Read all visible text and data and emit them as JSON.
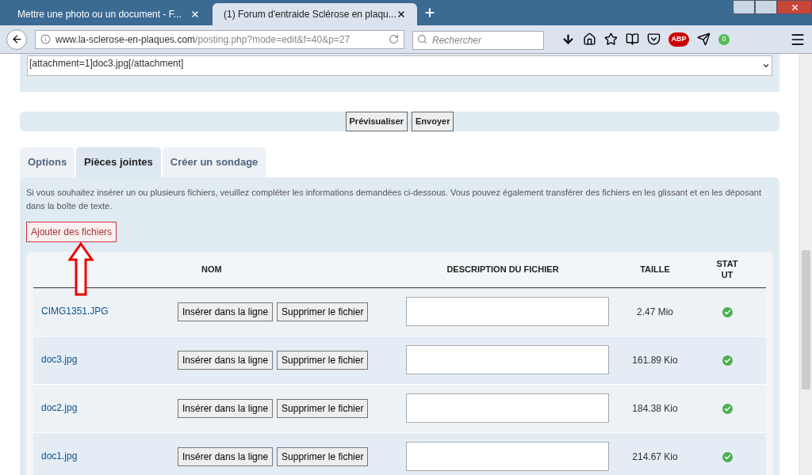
{
  "browser": {
    "tabs": [
      {
        "title": "Mettre une photo ou un document - F...",
        "selected": false
      },
      {
        "title": "(1) Forum d'entraide Sclérose en plaqu...",
        "selected": true
      }
    ],
    "url": {
      "domain": "www.la-sclerose-en-plaques.com",
      "path": "/posting.php?mode=edit&f=40&p=27"
    },
    "search": {
      "placeholder": "Rechercher"
    },
    "addon_badge": "0",
    "abp_label": "ABP"
  },
  "editor": {
    "value": "[attachment=1]doc3.jpg[/attachment]"
  },
  "actions": [
    "Prévisualiser",
    "Envoyer"
  ],
  "panel_tabs": [
    {
      "label": "Options",
      "selected": false
    },
    {
      "label": "Pièces jointes",
      "selected": true
    },
    {
      "label": "Créer un sondage",
      "selected": false
    }
  ],
  "intro": "Si vous souhaitez insérer un ou plusieurs fichiers, veuillez compléter les informations demandées ci-dessous. Vous pouvez également transférer des fichiers en les glissant et en les déposant dans la boîte de texte.",
  "add_files_button": "Ajouter des fichiers",
  "table": {
    "columns": [
      "NOM",
      "DESCRIPTION DU FICHIER",
      "TAILLE",
      "STATUT"
    ],
    "rows": [
      {
        "name": "CIMG1351.JPG",
        "insert": "Insérer dans la ligne",
        "delete": "Supprimer le fichier",
        "size": "2.47 Mio",
        "status_ok": true
      },
      {
        "name": "doc3.jpg",
        "insert": "Insérer dans la ligne",
        "delete": "Supprimer le fichier",
        "size": "161.89 Kio",
        "status_ok": true
      },
      {
        "name": "doc2.jpg",
        "insert": "Insérer dans la ligne",
        "delete": "Supprimer le fichier",
        "size": "184.38 Kio",
        "status_ok": true
      },
      {
        "name": "doc1.jpg",
        "insert": "Insérer dans la ligne",
        "delete": "Supprimer le fichier",
        "size": "214.67 Kio",
        "status_ok": true
      }
    ]
  }
}
